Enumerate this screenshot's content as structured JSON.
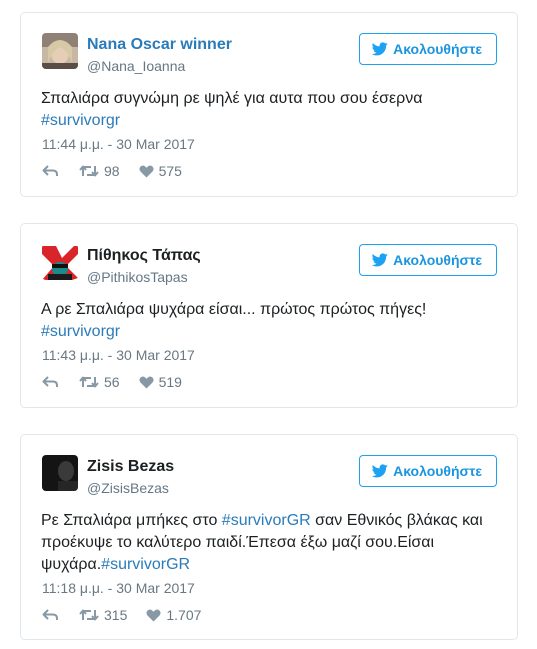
{
  "follow_label": "Ακολουθήστε",
  "icons": {
    "follow": "twitter-bird-icon",
    "reply": "reply-icon",
    "retweet": "retweet-icon",
    "like": "heart-icon"
  },
  "colors": {
    "link": "#2b7bb9",
    "follow_border": "#1da1f2",
    "muted": "#697882"
  },
  "tweets": [
    {
      "name": "Nana Oscar winner",
      "handle": "@Nana_Ioanna",
      "text_parts": [
        "Σπαλιάρα συγνώμη ρε ψηλέ για αυτα που σου έσερνα",
        "#survivorgr"
      ],
      "timestamp": "11:44 μ.μ. - 30 Mar 2017",
      "retweets": "98",
      "likes": "575"
    },
    {
      "name": "Πίθηκος Τάπας",
      "handle": "@PithikosTapas",
      "text_parts": [
        "Α ρε Σπαλιάρα ψυχάρα είσαι... πρώτος πρώτος πήγες!",
        "#survivorgr"
      ],
      "timestamp": "11:43 μ.μ. - 30 Mar 2017",
      "retweets": "56",
      "likes": "519"
    },
    {
      "name": "Zisis Bezas",
      "handle": "@ZisisBezas",
      "text_parts": [
        "Ρε Σπαλιάρα μπήκες στο ",
        "#survivorGR",
        " σαν Εθνικός βλάκας και",
        "προέκυψε το καλύτερο παιδί.Έπεσα έξω μαζί σου.Είσαι",
        "ψυχάρα.",
        "#survivorGR"
      ],
      "timestamp": "11:18 μ.μ. - 30 Mar 2017",
      "retweets": "315",
      "likes": "1.707"
    }
  ]
}
